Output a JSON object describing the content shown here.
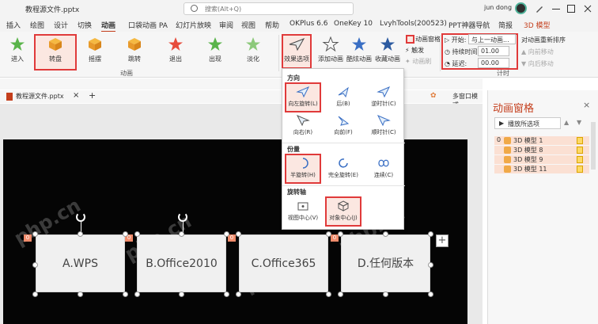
{
  "titlebar": {
    "doc_title": "教程源文件.pptx",
    "search_placeholder": "搜索(Alt+Q)",
    "user_name": "jun dong"
  },
  "tabs": [
    "插入",
    "绘图",
    "设计",
    "切换",
    "动画",
    "口袋动画 PA",
    "幻灯片放映",
    "审阅",
    "视图",
    "帮助",
    "OKPlus 6.6",
    "OneKey 10",
    "LvyhTools(200523)",
    "PPT神器导航",
    "简报",
    "3D 模型"
  ],
  "active_tab": "动画",
  "ribbon": {
    "animations": [
      "进入",
      "转盘",
      "摇摆",
      "跳转",
      "退出",
      "出现",
      "淡化"
    ],
    "effect_options": "效果选项",
    "add_animation": "添加动画",
    "animation_painter": "酷炫动画",
    "favorite_animation": "收藏动画",
    "animation_pane": "动画窗格",
    "trigger": "触发",
    "animation_brush": "动画刷",
    "group_animation": "动画",
    "group_timing": "计时",
    "start_label": "开始:",
    "start_value": "与上一动画...",
    "duration_label": "持续时间:",
    "duration_value": "01.00",
    "delay_label": "延迟:",
    "delay_value": "00.00",
    "reorder_label": "对动画重新排序",
    "move_earlier": "向前移动",
    "move_later": "向后移动"
  },
  "file_tab": {
    "name": "教程源文件.pptx",
    "multi_window": "多窗口模式"
  },
  "slide": {
    "cards": [
      "A.WPS",
      "B.Office2010",
      "C.Office365",
      "D.任何版本"
    ],
    "badge": "0",
    "watermark": "php.cn"
  },
  "dropdown": {
    "direction_title": "方向",
    "directions": [
      "向左旋转(L)",
      "后(B)",
      "逆时针(C)",
      "向右(R)",
      "向前(F)",
      "顺时针(C)"
    ],
    "amount_title": "份量",
    "amounts": [
      "半旋转(H)",
      "完全旋转(E)",
      "连续(C)"
    ],
    "axis_title": "旋转轴",
    "axes": [
      "视图中心(V)",
      "对象中心(J)"
    ]
  },
  "anim_pane": {
    "title": "动画窗格",
    "play_from": "播放所选项",
    "items": [
      {
        "num": "0",
        "label": "3D 模型 1"
      },
      {
        "num": "",
        "label": "3D 模型 8"
      },
      {
        "num": "",
        "label": "3D 模型 9"
      },
      {
        "num": "",
        "label": "3D 模型 11"
      }
    ]
  },
  "colors": {
    "accent": "#c43e1c",
    "highlight": "#e03a3a",
    "slide_bg": "#050505"
  }
}
